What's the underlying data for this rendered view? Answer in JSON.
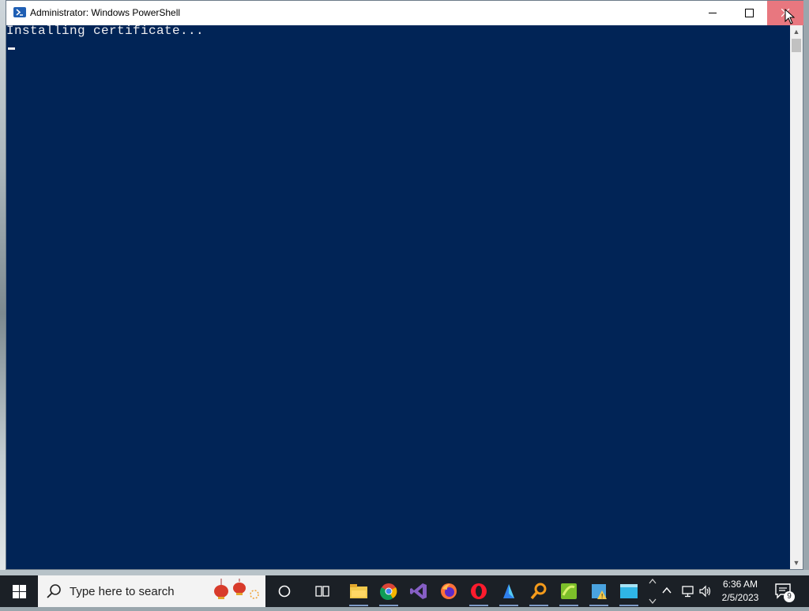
{
  "window": {
    "title": "Administrator: Windows PowerShell",
    "icon": "powershell-icon",
    "controls": {
      "minimize": "minimize-icon",
      "maximize": "maximize-icon",
      "close": "close-icon"
    }
  },
  "console": {
    "lines": [
      "Installing certificate..."
    ],
    "background": "#012456",
    "foreground": "#EEEDF0"
  },
  "taskbar": {
    "search_placeholder": "Type here to search",
    "pinned": [
      "cortana-icon",
      "task-view-icon",
      "file-explorer-icon",
      "chrome-icon",
      "visual-studio-icon",
      "firefox-icon",
      "opera-icon",
      "app-icon",
      "search-app-icon",
      "app-icon-2",
      "app-icon-3",
      "app-icon-4"
    ],
    "clock_time": "6:36 AM",
    "clock_date": "2/5/2023",
    "notification_count": "9"
  }
}
